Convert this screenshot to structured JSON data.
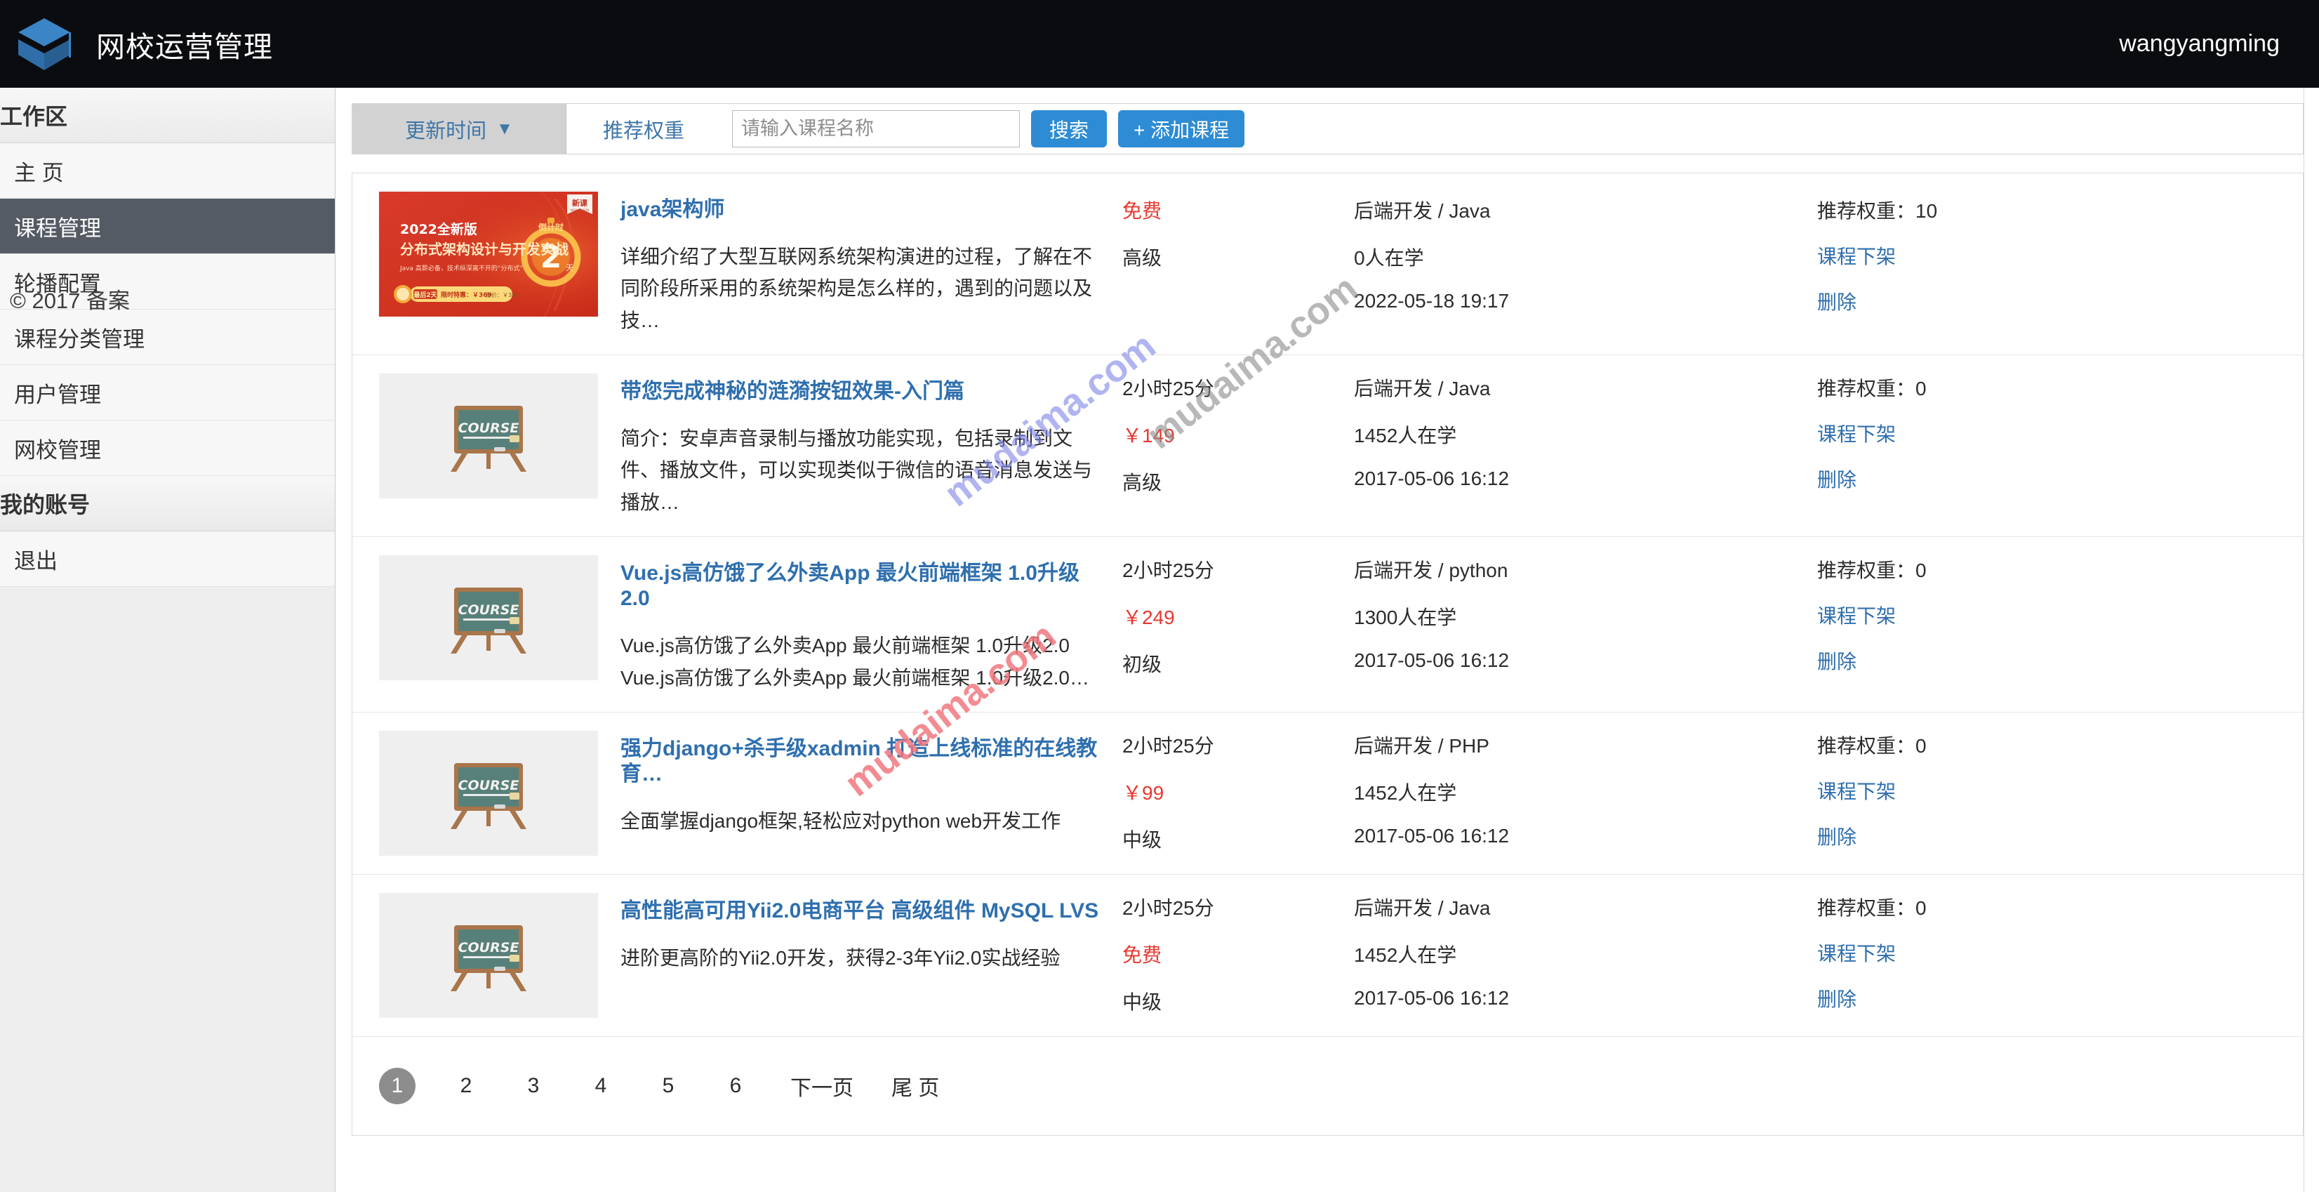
{
  "header": {
    "brand_title": "网校运营管理",
    "username": "wangyangming",
    "logo_icon": "cube-graduation-logo"
  },
  "sidebar": {
    "section_workspace": "工作区",
    "items": [
      {
        "label": "主 页",
        "active": false
      },
      {
        "label": "课程管理",
        "active": true
      },
      {
        "label": "轮播配置",
        "active": false
      },
      {
        "label": "课程分类管理",
        "active": false
      },
      {
        "label": "用户管理",
        "active": false
      },
      {
        "label": "网校管理",
        "active": false
      }
    ],
    "section_account": "我的账号",
    "account_items": [
      {
        "label": "退出"
      }
    ],
    "footer": "© 2017  备案"
  },
  "toolbar": {
    "sort_update_time": "更新时间",
    "sort_caret": "▼",
    "sort_recommend_weight": "推荐权重",
    "search_placeholder": "请输入课程名称",
    "search_value": "",
    "search_button": "搜索",
    "add_course_button": "+ 添加课程"
  },
  "labels": {
    "weight_prefix": "推荐权重：",
    "take_down": "课程下架",
    "delete": "删除"
  },
  "courses": [
    {
      "thumb": "banner-2022-distributed-architecture",
      "thumb_texts": {
        "badge": "新课",
        "badge_sub": "NEW LESSON",
        "line1": "2022全新版",
        "line2": "分布式架构设计与开发实战",
        "line3": "Java 高薪必备，技术纵深离不开的“分布式”",
        "countdown_label": "倒计时",
        "countdown_num": "2",
        "countdown_unit": "天",
        "promo_tag": "最后2天",
        "promo_price": "限时特惠：￥369",
        "promo_old": "原价：￥399"
      },
      "title": "java架构师",
      "desc": "详细介绍了大型互联网系统架构演进的过程，了解在不同阶段所采用的系统架构是怎么样的，遇到的问题以及技…",
      "duration": "",
      "price": "免费",
      "price_free": true,
      "level": "高级",
      "category": "后端开发 / Java",
      "students": "0人在学",
      "updated": "2022-05-18 19:17",
      "weight": "10"
    },
    {
      "thumb": "course-placeholder-chalkboard",
      "title": "带您完成神秘的涟漪按钮效果-入门篇",
      "desc": "简介：安卓声音录制与播放功能实现，包括录制到文件、播放文件，可以实现类似于微信的语音消息发送与播放…",
      "duration": "2小时25分",
      "price": "￥149",
      "price_free": false,
      "level": "高级",
      "category": "后端开发 / Java",
      "students": "1452人在学",
      "updated": "2017-05-06 16:12",
      "weight": "0"
    },
    {
      "thumb": "course-placeholder-chalkboard",
      "title": "Vue.js高仿饿了么外卖App 最火前端框架 1.0升级2.0",
      "desc": "Vue.js高仿饿了么外卖App 最火前端框架 1.0升级2.0 Vue.js高仿饿了么外卖App 最火前端框架 1.0升级2.0…",
      "duration": "2小时25分",
      "price": "￥249",
      "price_free": false,
      "level": "初级",
      "category": "后端开发 / python",
      "students": "1300人在学",
      "updated": "2017-05-06 16:12",
      "weight": "0"
    },
    {
      "thumb": "course-placeholder-chalkboard",
      "title": "强力django+杀手级xadmin 打造上线标准的在线教育…",
      "desc": "全面掌握django框架,轻松应对python web开发工作",
      "duration": "2小时25分",
      "price": "￥99",
      "price_free": false,
      "level": "中级",
      "category": "后端开发 / PHP",
      "students": "1452人在学",
      "updated": "2017-05-06 16:12",
      "weight": "0"
    },
    {
      "thumb": "course-placeholder-chalkboard",
      "title": "高性能高可用Yii2.0电商平台 高级组件 MySQL LVS",
      "desc": "进阶更高阶的Yii2.0开发，获得2-3年Yii2.0实战经验",
      "duration": "2小时25分",
      "price": "免费",
      "price_free": true,
      "level": "中级",
      "category": "后端开发 / Java",
      "students": "1452人在学",
      "updated": "2017-05-06 16:12",
      "weight": "0"
    }
  ],
  "pagination": {
    "pages": [
      "1",
      "2",
      "3",
      "4",
      "5",
      "6"
    ],
    "active_page": "1",
    "next_label": "下一页",
    "last_label": "尾 页"
  },
  "watermarks": [
    {
      "text": "mudaima.com",
      "color": "#8187e8"
    },
    {
      "text": "mudaima.com",
      "color": "#8a8a8a"
    },
    {
      "text": "mudaima.com",
      "color": "#f0787f"
    }
  ]
}
